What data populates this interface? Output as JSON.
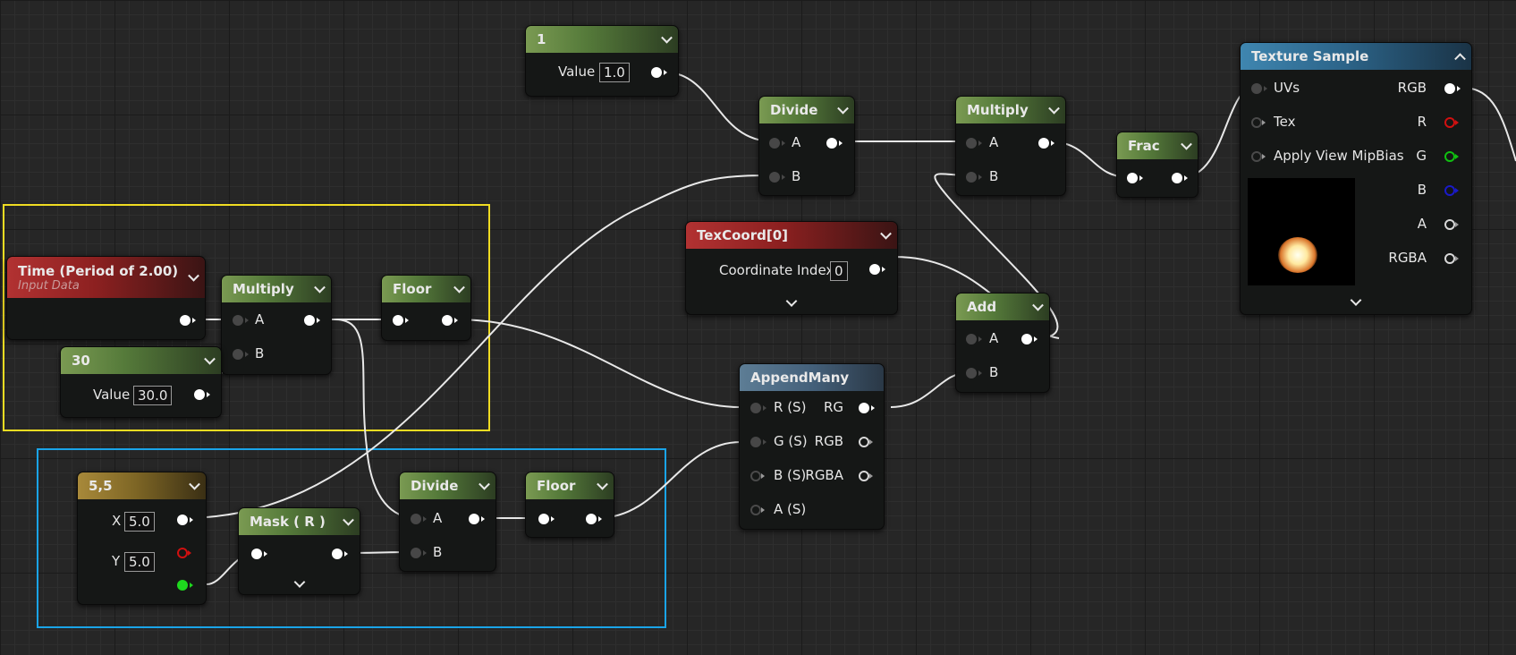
{
  "nodes": {
    "const_1": {
      "title": "1",
      "value_label": "Value",
      "value": "1.0"
    },
    "divide_top": {
      "title": "Divide",
      "pin_a": "A",
      "pin_b": "B"
    },
    "multiply_top": {
      "title": "Multiply",
      "pin_a": "A",
      "pin_b": "B"
    },
    "frac": {
      "title": "Frac"
    },
    "texture_sample": {
      "title": "Texture Sample",
      "inputs": [
        "UVs",
        "Tex",
        "Apply View MipBias"
      ],
      "outputs": [
        "RGB",
        "R",
        "G",
        "B",
        "A",
        "RGBA"
      ]
    },
    "texcoord": {
      "title": "TexCoord[0]",
      "label": "Coordinate Index",
      "value": "0"
    },
    "add": {
      "title": "Add",
      "pin_a": "A",
      "pin_b": "B"
    },
    "time": {
      "title": "Time (Period of 2.00)",
      "subtitle": "Input Data"
    },
    "multiply_left": {
      "title": "Multiply",
      "pin_a": "A",
      "pin_b": "B"
    },
    "floor_top": {
      "title": "Floor"
    },
    "const_30": {
      "title": "30",
      "value_label": "Value",
      "value": "30.0"
    },
    "append_many": {
      "title": "AppendMany",
      "inputs": [
        "R (S)",
        "G (S)",
        "B (S)",
        "A (S)"
      ],
      "outputs": [
        "RG",
        "RGB",
        "RGBA"
      ]
    },
    "const_55": {
      "title": "5,5",
      "x_label": "X",
      "x_value": "5.0",
      "y_label": "Y",
      "y_value": "5.0"
    },
    "mask_r": {
      "title": "Mask ( R )"
    },
    "divide_bottom": {
      "title": "Divide",
      "pin_a": "A",
      "pin_b": "B"
    },
    "floor_bottom": {
      "title": "Floor"
    }
  },
  "comments": [
    {
      "color": "#f0dc22"
    },
    {
      "color": "#1aa4e8"
    }
  ]
}
